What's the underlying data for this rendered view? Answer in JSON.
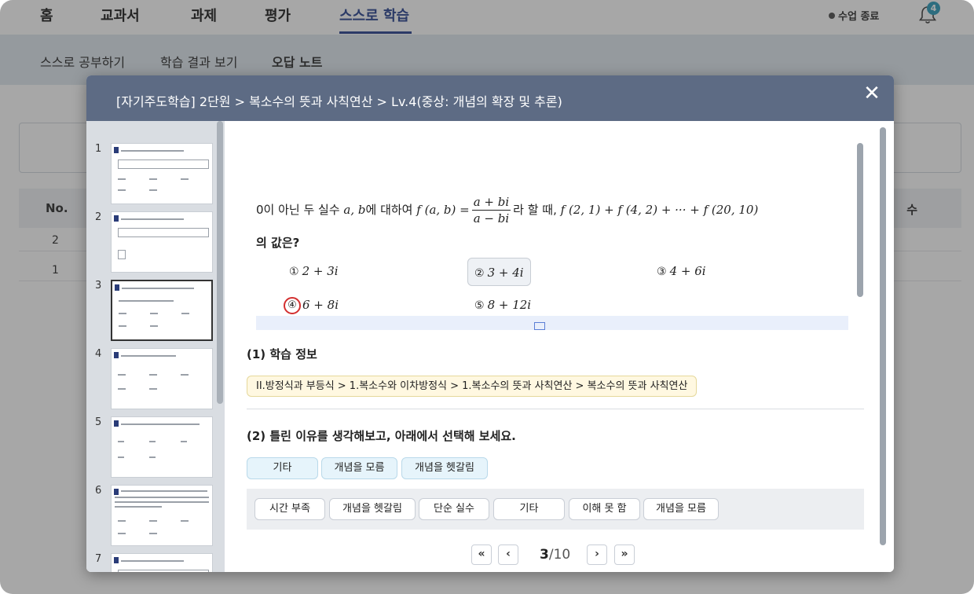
{
  "nav": {
    "tabs": [
      "홈",
      "교과서",
      "과제",
      "평가",
      "스스로 학습"
    ],
    "active_tab": "스스로 학습",
    "end_class": "수업 종료",
    "notification_count": "4"
  },
  "subnav": {
    "items": [
      "스스로 공부하기",
      "학습 결과 보기",
      "오답 노트"
    ],
    "active": "오답 노트"
  },
  "background_table": {
    "header_no": "No.",
    "header_right": "수",
    "rows": [
      "2",
      "1"
    ]
  },
  "modal": {
    "title": "[자기주도학습] 2단원 > 복소수의 뜻과 사칙연산 > Lv.4(중상: 개념의 확장 및 추론)",
    "close_icon": "close-icon",
    "thumbnails": [
      "1",
      "2",
      "3",
      "4",
      "5",
      "6",
      "7"
    ],
    "selected_thumbnail": "3",
    "question": {
      "part1": "0이 아닌 두 실수 ",
      "vars": "a, b",
      "part2": "에 대하여 ",
      "fn_lhs": "f (a,  b) =",
      "frac_num": "a + bi",
      "frac_den": "a − bi",
      "part3": "라 할 때, ",
      "sum_expr": "f (2,  1) + f (4,  2) + ··· + f (20,  10)",
      "line2": "의 값은?",
      "options": [
        {
          "mark": "①",
          "expr": "2 + 3i"
        },
        {
          "mark": "②",
          "expr": "3 + 4i"
        },
        {
          "mark": "③",
          "expr": "4 + 6i"
        },
        {
          "mark": "④",
          "expr": "6 + 8i"
        },
        {
          "mark": "⑤",
          "expr": "8 + 12i"
        }
      ],
      "selected_option": "②",
      "circled_option": "④"
    },
    "section1_title": "(1) 학습 정보",
    "learning_path": "II.방정식과 부등식 > 1.복소수와 이차방정식 > 1.복소수의 뜻과 사칙연산 > 복소수의 뜻과 사칙연산",
    "section2_title": "(2) 틀린 이유를 생각해보고, 아래에서 선택해 보세요.",
    "selected_reasons": [
      "기타",
      "개념을 모름",
      "개념을 헷갈림"
    ],
    "reason_choices": [
      "시간 부족",
      "개념을 헷갈림",
      "단순 실수",
      "기타",
      "이해 못 함",
      "개념을 모름"
    ],
    "pager": {
      "first": "«",
      "prev": "‹",
      "next": "›",
      "last": "»",
      "current": "3",
      "total": "/10"
    }
  }
}
